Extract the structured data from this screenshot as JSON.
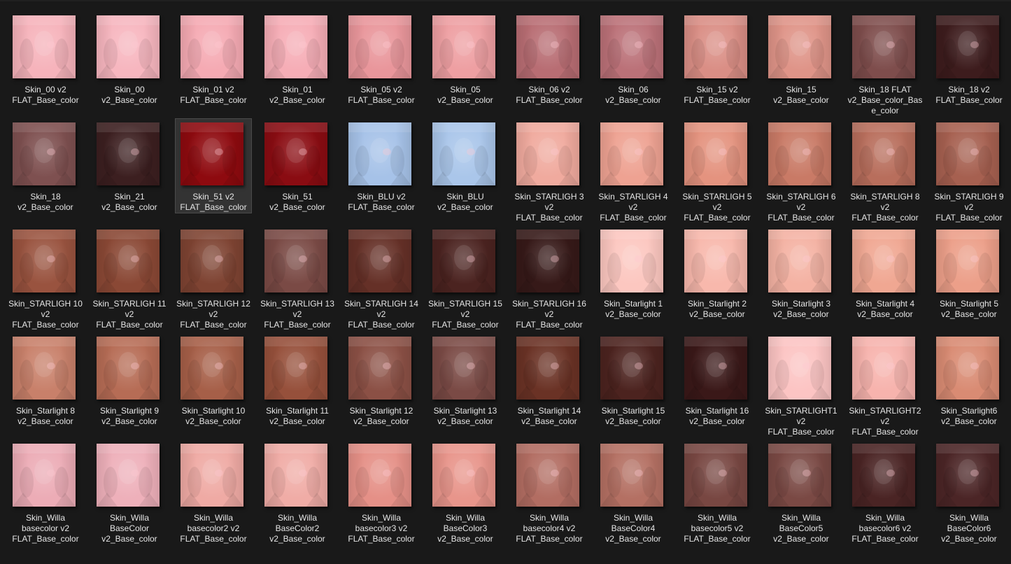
{
  "files": [
    {
      "name": "Skin_00 v2\nFLAT_Base_color",
      "color": "#f6b3bb",
      "selected": false
    },
    {
      "name": "Skin_00\nv2_Base_color",
      "color": "#f7b6bf",
      "selected": false
    },
    {
      "name": "Skin_01 v2\nFLAT_Base_color",
      "color": "#f5aab3",
      "selected": false
    },
    {
      "name": "Skin_01\nv2_Base_color",
      "color": "#f6adb6",
      "selected": false
    },
    {
      "name": "Skin_05 v2\nFLAT_Base_color",
      "color": "#e9969b",
      "selected": false
    },
    {
      "name": "Skin_05\nv2_Base_color",
      "color": "#ee9fa2",
      "selected": false
    },
    {
      "name": "Skin_06 v2\nFLAT_Base_color",
      "color": "#b86d73",
      "selected": false
    },
    {
      "name": "Skin_06\nv2_Base_color",
      "color": "#bb7178",
      "selected": false
    },
    {
      "name": "Skin_15 v2\nFLAT_Base_color",
      "color": "#da8e85",
      "selected": false
    },
    {
      "name": "Skin_15\nv2_Base_color",
      "color": "#df9488",
      "selected": false
    },
    {
      "name": "Skin_18 FLAT\nv2_Base_color_Bas\ne_color",
      "color": "#7e4d4c",
      "selected": false
    },
    {
      "name": "Skin_18 v2\nFLAT_Base_color",
      "color": "#3d1c1d",
      "selected": false
    },
    {
      "name": "Skin_18\nv2_Base_color",
      "color": "#7e5050",
      "selected": false
    },
    {
      "name": "Skin_21\nv2_Base_color",
      "color": "#3c1f20",
      "selected": false
    },
    {
      "name": "Skin_51 v2\nFLAT_Base_color",
      "color": "#8e0a0f",
      "selected": true
    },
    {
      "name": "Skin_51\nv2_Base_color",
      "color": "#8a0c12",
      "selected": false
    },
    {
      "name": "Skin_BLU v2\nFLAT_Base_color",
      "color": "#a6c2e8",
      "selected": false
    },
    {
      "name": "Skin_BLU\nv2_Base_color",
      "color": "#aac6ea",
      "selected": false
    },
    {
      "name": "Skin_STARLIGH 3\nv2\nFLAT_Base_color",
      "color": "#f0aa9e",
      "selected": false
    },
    {
      "name": "Skin_STARLIGH 4\nv2\nFLAT_Base_color",
      "color": "#eea292",
      "selected": false
    },
    {
      "name": "Skin_STARLIGH 5\nv2\nFLAT_Base_color",
      "color": "#e4937f",
      "selected": false
    },
    {
      "name": "Skin_STARLIGH 6\nv2\nFLAT_Base_color",
      "color": "#c97a66",
      "selected": false
    },
    {
      "name": "Skin_STARLIGH 8\nv2\nFLAT_Base_color",
      "color": "#b86e5c",
      "selected": false
    },
    {
      "name": "Skin_STARLIGH 9\nv2\nFLAT_Base_color",
      "color": "#a66050",
      "selected": false
    },
    {
      "name": "Skin_STARLIGH 10\nv2\nFLAT_Base_color",
      "color": "#99533f",
      "selected": false
    },
    {
      "name": "Skin_STARLIGH 11\nv2\nFLAT_Base_color",
      "color": "#8a4835",
      "selected": false
    },
    {
      "name": "Skin_STARLIGH 12\nv2\nFLAT_Base_color",
      "color": "#7e4332",
      "selected": false
    },
    {
      "name": "Skin_STARLIGH 13\nv2\nFLAT_Base_color",
      "color": "#7a4a45",
      "selected": false
    },
    {
      "name": "Skin_STARLIGH 14\nv2\nFLAT_Base_color",
      "color": "#653027",
      "selected": false
    },
    {
      "name": "Skin_STARLIGH 15\nv2\nFLAT_Base_color",
      "color": "#4b2320",
      "selected": false
    },
    {
      "name": "Skin_STARLIGH 16\nv2\nFLAT_Base_color",
      "color": "#361918",
      "selected": false
    },
    {
      "name": "Skin_Starlight 1\nv2_Base_color",
      "color": "#fcc7c0",
      "selected": false
    },
    {
      "name": "Skin_Starlight 2\nv2_Base_color",
      "color": "#f8b8ac",
      "selected": false
    },
    {
      "name": "Skin_Starlight 3\nv2_Base_color",
      "color": "#f4b2a3",
      "selected": false
    },
    {
      "name": "Skin_Starlight 4\nv2_Base_color",
      "color": "#f0a792",
      "selected": false
    },
    {
      "name": "Skin_Starlight 5\nv2_Base_color",
      "color": "#ec9f89",
      "selected": false
    },
    {
      "name": "Skin_Starlight 8\nv2_Base_color",
      "color": "#c8806a",
      "selected": false
    },
    {
      "name": "Skin_Starlight 9\nv2_Base_color",
      "color": "#b66c55",
      "selected": false
    },
    {
      "name": "Skin_Starlight 10\nv2_Base_color",
      "color": "#a65f48",
      "selected": false
    },
    {
      "name": "Skin_Starlight 11\nv2_Base_color",
      "color": "#96503b",
      "selected": false
    },
    {
      "name": "Skin_Starlight 12\nv2_Base_color",
      "color": "#8b5045",
      "selected": false
    },
    {
      "name": "Skin_Starlight 13\nv2_Base_color",
      "color": "#7a4a45",
      "selected": false
    },
    {
      "name": "Skin_Starlight 14\nv2_Base_color",
      "color": "#6a3225",
      "selected": false
    },
    {
      "name": "Skin_Starlight 15\nv2_Base_color",
      "color": "#4c231f",
      "selected": false
    },
    {
      "name": "Skin_Starlight 16\nv2_Base_color",
      "color": "#3a1818",
      "selected": false
    },
    {
      "name": "Skin_STARLIGHT1\nv2\nFLAT_Base_color",
      "color": "#fcc4c3",
      "selected": false
    },
    {
      "name": "Skin_STARLIGHT2\nv2\nFLAT_Base_color",
      "color": "#f7b3ad",
      "selected": false
    },
    {
      "name": "Skin_Starlight6\nv2_Base_color",
      "color": "#d98b73",
      "selected": false
    },
    {
      "name": "Skin_Willa\nbasecolor v2\nFLAT_Base_color",
      "color": "#ecacb6",
      "selected": false
    },
    {
      "name": "Skin_Willa\nBaseColor\nv2_Base_color",
      "color": "#eeb0ba",
      "selected": false
    },
    {
      "name": "Skin_Willa\nbasecolor2 v2\nFLAT_Base_color",
      "color": "#efaaa4",
      "selected": false
    },
    {
      "name": "Skin_Willa\nBaseColor2\nv2_Base_color",
      "color": "#f0aca6",
      "selected": false
    },
    {
      "name": "Skin_Willa\nbasecolor3 v2\nFLAT_Base_color",
      "color": "#e59087",
      "selected": false
    },
    {
      "name": "Skin_Willa\nBaseColor3\nv2_Base_color",
      "color": "#e8958b",
      "selected": false
    },
    {
      "name": "Skin_Willa\nbasecolor4 v2\nFLAT_Base_color",
      "color": "#b26d62",
      "selected": false
    },
    {
      "name": "Skin_Willa\nBaseColor4\nv2_Base_color",
      "color": "#b47063",
      "selected": false
    },
    {
      "name": "Skin_Willa\nbasecolor5 v2\nFLAT_Base_color",
      "color": "#784742",
      "selected": false
    },
    {
      "name": "Skin_Willa\nBaseColor5\nv2_Base_color",
      "color": "#7a4944",
      "selected": false
    },
    {
      "name": "Skin_Willa\nbasecolor6 v2\nFLAT_Base_color",
      "color": "#4a2424",
      "selected": false
    },
    {
      "name": "Skin_Willa\nBaseColor6\nv2_Base_color",
      "color": "#4b2526",
      "selected": false
    }
  ]
}
